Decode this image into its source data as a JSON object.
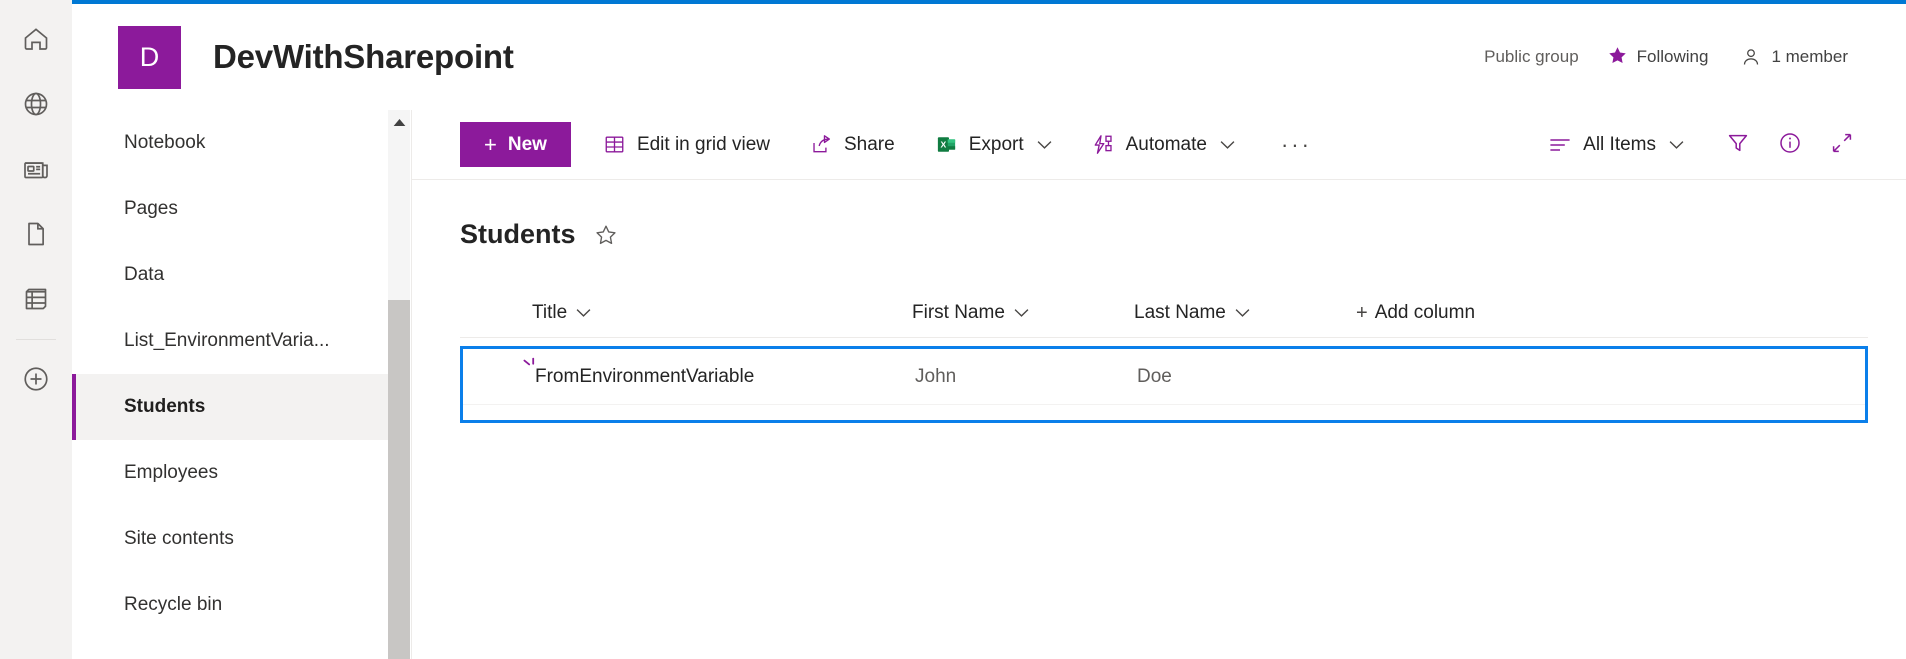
{
  "colors": {
    "brand_purple": "#8c1a9b",
    "accent_blue": "#0078d4",
    "focus_blue": "#0b7fea",
    "rail_bg": "#f3f2f1",
    "selected_nav_bg": "#f3f2f1"
  },
  "app_rail": {
    "items": [
      {
        "icon": "home-icon",
        "label": "Home"
      },
      {
        "icon": "globe-icon",
        "label": "My sites"
      },
      {
        "icon": "news-icon",
        "label": "News"
      },
      {
        "icon": "document-icon",
        "label": "Files"
      },
      {
        "icon": "list-icon",
        "label": "Lists"
      },
      {
        "icon": "create-circle-plus-icon",
        "label": "Create"
      }
    ]
  },
  "site_header": {
    "logo_letter": "D",
    "title": "DevWithSharepoint",
    "privacy_label": "Public group",
    "following_label": "Following",
    "members_label": "1 member"
  },
  "sidebar": {
    "items": [
      {
        "label": "Notebook",
        "selected": false
      },
      {
        "label": "Pages",
        "selected": false
      },
      {
        "label": "Data",
        "selected": false
      },
      {
        "label": "List_EnvironmentVaria...",
        "selected": false
      },
      {
        "label": "Students",
        "selected": true
      },
      {
        "label": "Employees",
        "selected": false
      },
      {
        "label": "Site contents",
        "selected": false
      },
      {
        "label": "Recycle bin",
        "selected": false
      }
    ]
  },
  "command_bar": {
    "new_label": "New",
    "new_plus": "+",
    "edit_grid_label": "Edit in grid view",
    "share_label": "Share",
    "export_label": "Export",
    "automate_label": "Automate",
    "overflow_label": "···",
    "view_label": "All Items"
  },
  "list": {
    "title": "Students",
    "columns": [
      {
        "label": "Title"
      },
      {
        "label": "First Name"
      },
      {
        "label": "Last Name"
      }
    ],
    "add_column_label": "Add column",
    "add_column_plus": "+",
    "rows": [
      {
        "title": "FromEnvironmentVariable",
        "first_name": "John",
        "last_name": "Doe",
        "is_new": true,
        "selected": true
      }
    ]
  }
}
